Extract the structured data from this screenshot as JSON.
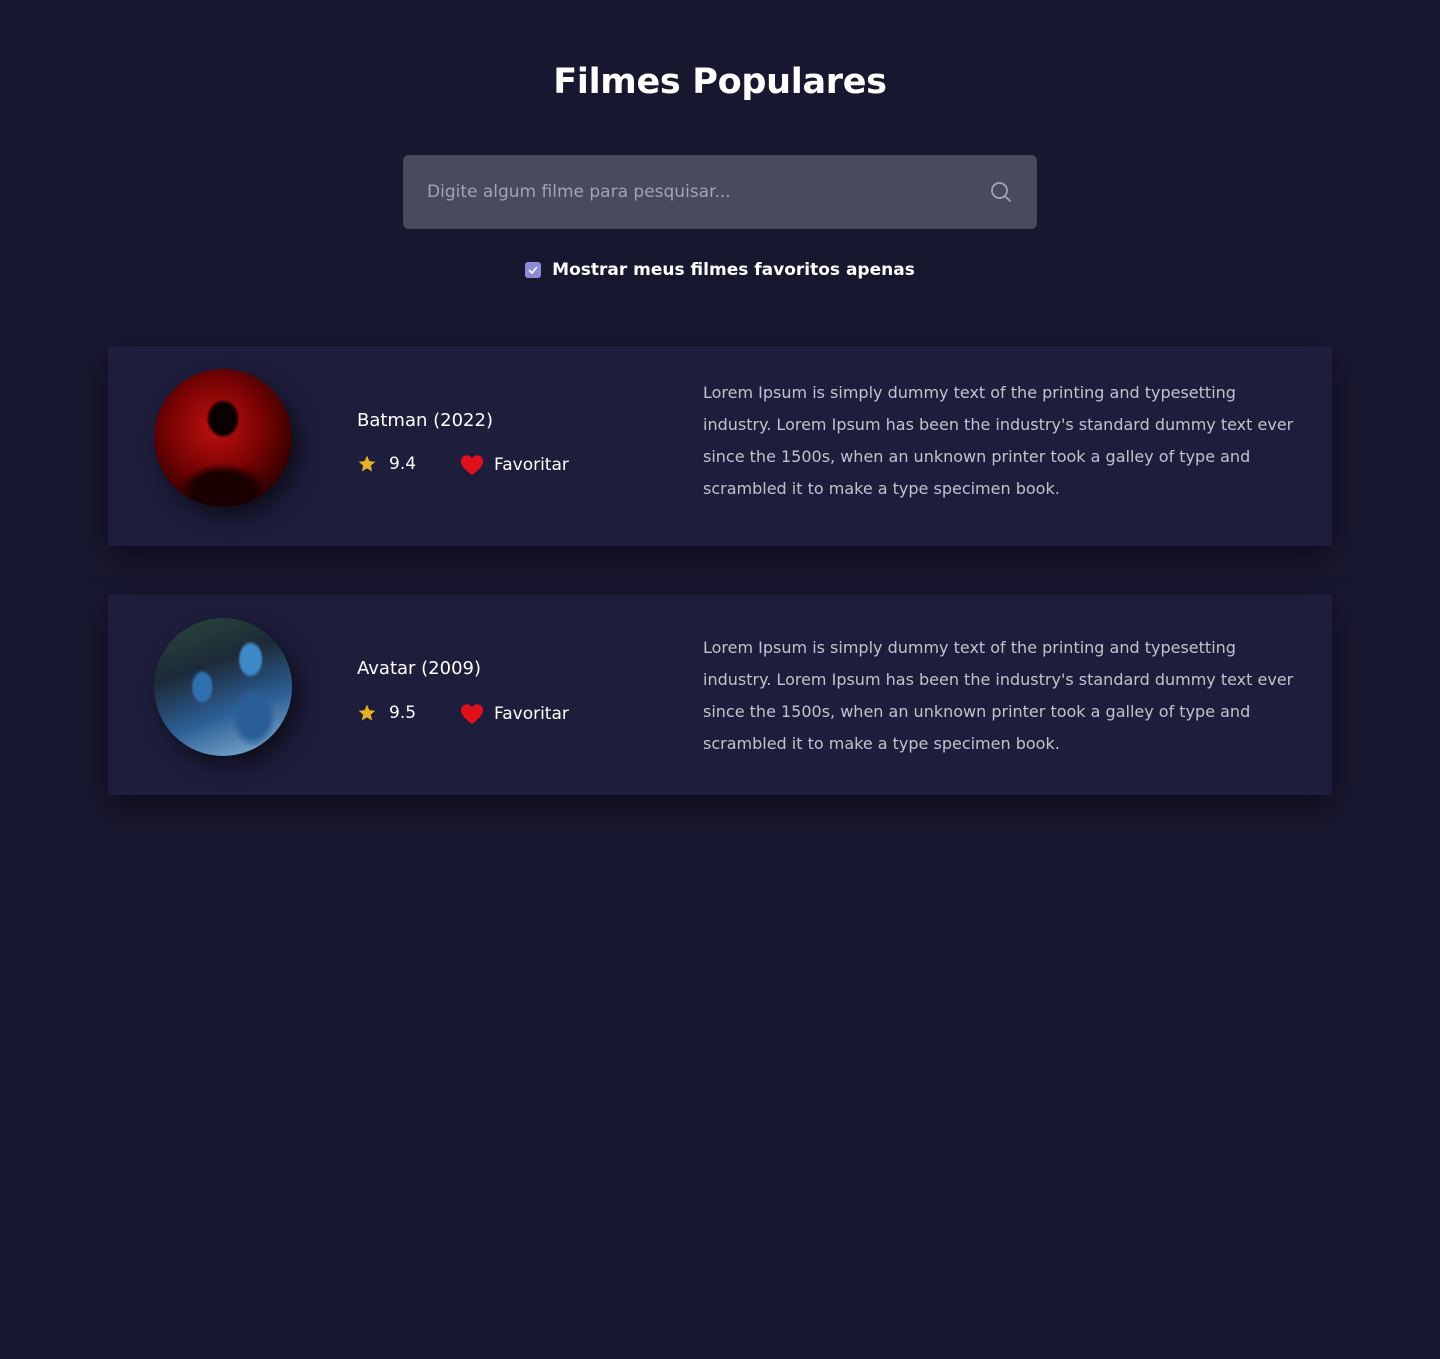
{
  "header": {
    "title": "Filmes Populares"
  },
  "search": {
    "placeholder": "Digite algum filme para pesquisar..."
  },
  "filter": {
    "label": "Mostrar meus filmes favoritos apenas",
    "checked": true
  },
  "movies": [
    {
      "title": "Batman (2022)",
      "rating": "9.4",
      "favorite_label": "Favoritar",
      "description": "Lorem Ipsum is simply dummy text of the printing and typesetting industry. Lorem Ipsum has been the industry's standard dummy text ever since the 1500s, when an unknown printer took a galley of type and scrambled it to make a type specimen book."
    },
    {
      "title": "Avatar (2009)",
      "rating": "9.5",
      "favorite_label": "Favoritar",
      "description": "Lorem Ipsum is simply dummy text of the printing and typesetting industry. Lorem Ipsum has been the industry's standard dummy text ever since the 1500s, when an unknown printer took a galley of type and scrambled it to make a type specimen book."
    }
  ],
  "colors": {
    "background": "#181730",
    "card": "#1e1d3c",
    "search_bg": "#4a4a5e",
    "star": "#e5b125",
    "heart": "#e0101b",
    "checkbox": "#8d8ad6"
  },
  "icons": [
    "search-icon",
    "check-icon",
    "star-icon",
    "heart-icon"
  ]
}
